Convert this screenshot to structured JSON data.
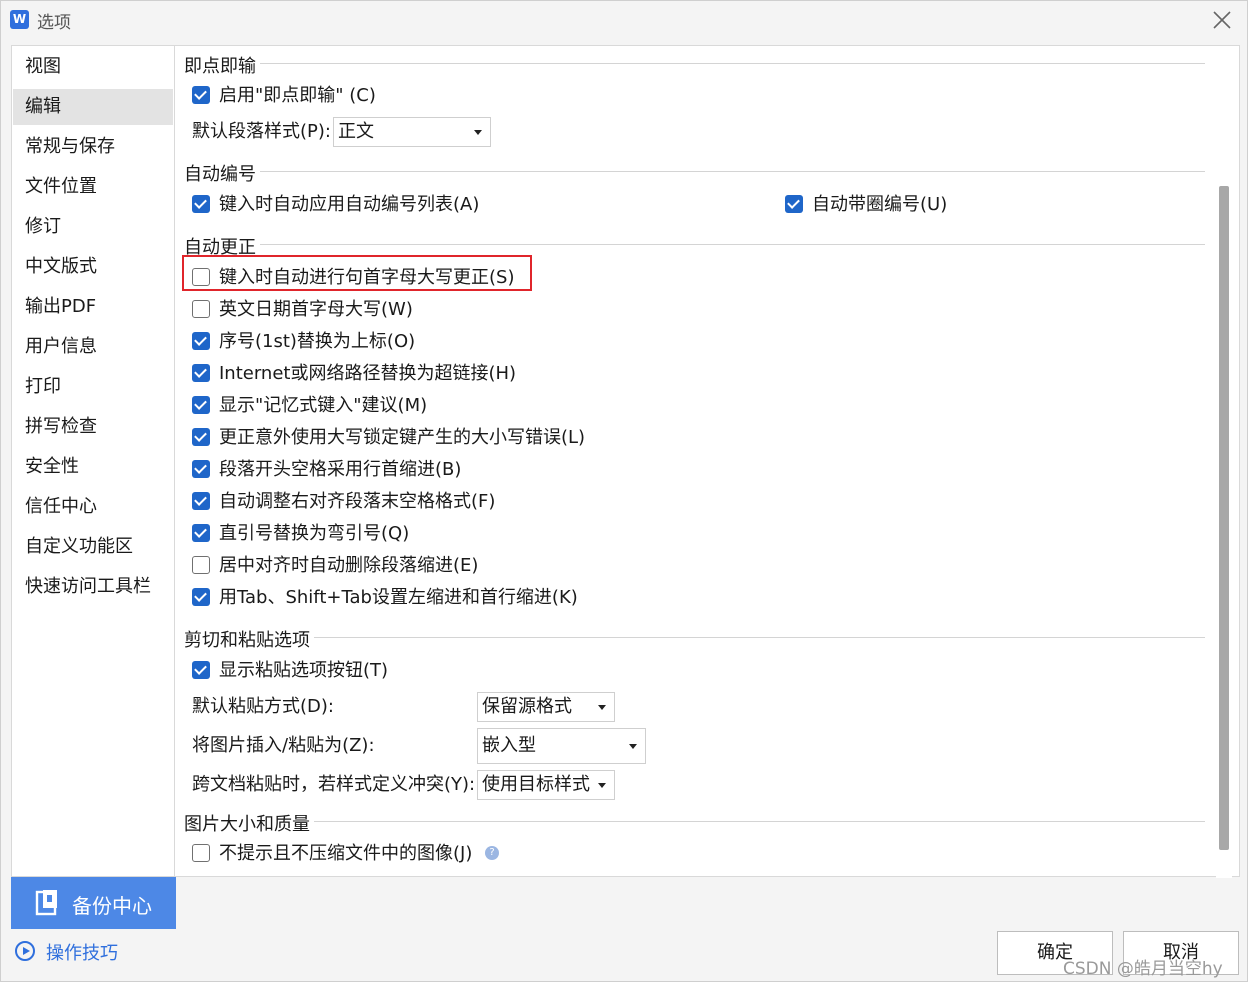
{
  "window": {
    "title": "选项",
    "app_icon": "W"
  },
  "sidebar": {
    "items": [
      {
        "label": "视图",
        "selected": false
      },
      {
        "label": "编辑",
        "selected": true
      },
      {
        "label": "常规与保存",
        "selected": false
      },
      {
        "label": "文件位置",
        "selected": false
      },
      {
        "label": "修订",
        "selected": false
      },
      {
        "label": "中文版式",
        "selected": false
      },
      {
        "label": "输出PDF",
        "selected": false
      },
      {
        "label": "用户信息",
        "selected": false
      },
      {
        "label": "打印",
        "selected": false
      },
      {
        "label": "拼写检查",
        "selected": false
      },
      {
        "label": "安全性",
        "selected": false
      },
      {
        "label": "信任中心",
        "selected": false
      },
      {
        "label": "自定义功能区",
        "selected": false
      },
      {
        "label": "快速访问工具栏",
        "selected": false
      }
    ],
    "backup_label": "备份中心",
    "tips_label": "操作技巧"
  },
  "sections": {
    "click_type": {
      "title": "即点即输",
      "enable": {
        "label": "启用\"即点即输\" (C)",
        "checked": true
      },
      "default_style_label": "默认段落样式(P):",
      "default_style_value": "正文"
    },
    "auto_number": {
      "title": "自动编号",
      "apply_list": {
        "label": "键入时自动应用自动编号列表(A)",
        "checked": true
      },
      "circle_number": {
        "label": "自动带圈编号(U)",
        "checked": true
      }
    },
    "auto_correct": {
      "title": "自动更正",
      "options": [
        {
          "label": "键入时自动进行句首字母大写更正(S)",
          "checked": false
        },
        {
          "label": "英文日期首字母大写(W)",
          "checked": false
        },
        {
          "label": "序号(1st)替换为上标(O)",
          "checked": true
        },
        {
          "label": "Internet或网络路径替换为超链接(H)",
          "checked": true
        },
        {
          "label": "显示\"记忆式键入\"建议(M)",
          "checked": true
        },
        {
          "label": "更正意外使用大写锁定键产生的大小写错误(L)",
          "checked": true
        },
        {
          "label": "段落开头空格采用行首缩进(B)",
          "checked": true
        },
        {
          "label": "自动调整右对齐段落末空格格式(F)",
          "checked": true
        },
        {
          "label": "直引号替换为弯引号(Q)",
          "checked": true
        },
        {
          "label": "居中对齐时自动删除段落缩进(E)",
          "checked": false
        },
        {
          "label": "用Tab、Shift+Tab设置左缩进和首行缩进(K)",
          "checked": true
        }
      ]
    },
    "paste": {
      "title": "剪切和粘贴选项",
      "show_button": {
        "label": "显示粘贴选项按钮(T)",
        "checked": true
      },
      "default_paste_label": "默认粘贴方式(D):",
      "default_paste_value": "保留源格式",
      "image_insert_label": "将图片插入/粘贴为(Z):",
      "image_insert_value": "嵌入型",
      "cross_doc_label": "跨文档粘贴时，若样式定义冲突(Y):",
      "cross_doc_value": "使用目标样式"
    },
    "image_quality": {
      "title": "图片大小和质量",
      "no_compress": {
        "label": "不提示且不压缩文件中的图像(J)",
        "checked": false
      }
    }
  },
  "buttons": {
    "ok": "确定",
    "cancel": "取消"
  },
  "watermark": "CSDN @皓月当空hy"
}
